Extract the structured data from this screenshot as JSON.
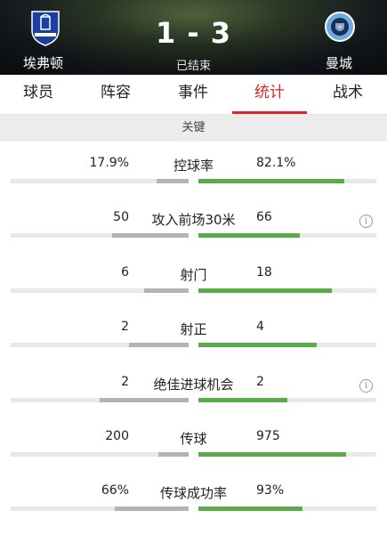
{
  "match": {
    "home_team": "埃弗顿",
    "away_team": "曼城",
    "score": "1 - 3",
    "status": "已结束"
  },
  "tabs": [
    {
      "label": "球员"
    },
    {
      "label": "阵容"
    },
    {
      "label": "事件"
    },
    {
      "label": "统计",
      "active": true
    },
    {
      "label": "战术"
    }
  ],
  "section_title": "关键",
  "colors": {
    "accent": "#d9262c",
    "away_bar": "#5aac4b",
    "home_bar": "#b3b3b5"
  },
  "stats": [
    {
      "label": "控球率",
      "home": "17.9%",
      "away": "82.1%",
      "home_share": 0.179,
      "away_share": 0.821,
      "info": false
    },
    {
      "label": "攻入前场30米",
      "home": "50",
      "away": "66",
      "home_share": 0.431,
      "away_share": 0.569,
      "info": true
    },
    {
      "label": "射门",
      "home": "6",
      "away": "18",
      "home_share": 0.25,
      "away_share": 0.75,
      "info": false
    },
    {
      "label": "射正",
      "home": "2",
      "away": "4",
      "home_share": 0.333,
      "away_share": 0.667,
      "info": false
    },
    {
      "label": "绝佳进球机会",
      "home": "2",
      "away": "2",
      "home_share": 0.5,
      "away_share": 0.5,
      "info": true
    },
    {
      "label": "传球",
      "home": "200",
      "away": "975",
      "home_share": 0.17,
      "away_share": 0.83,
      "info": false
    },
    {
      "label": "传球成功率",
      "home": "66%",
      "away": "93%",
      "home_share": 0.415,
      "away_share": 0.585,
      "info": false
    }
  ]
}
